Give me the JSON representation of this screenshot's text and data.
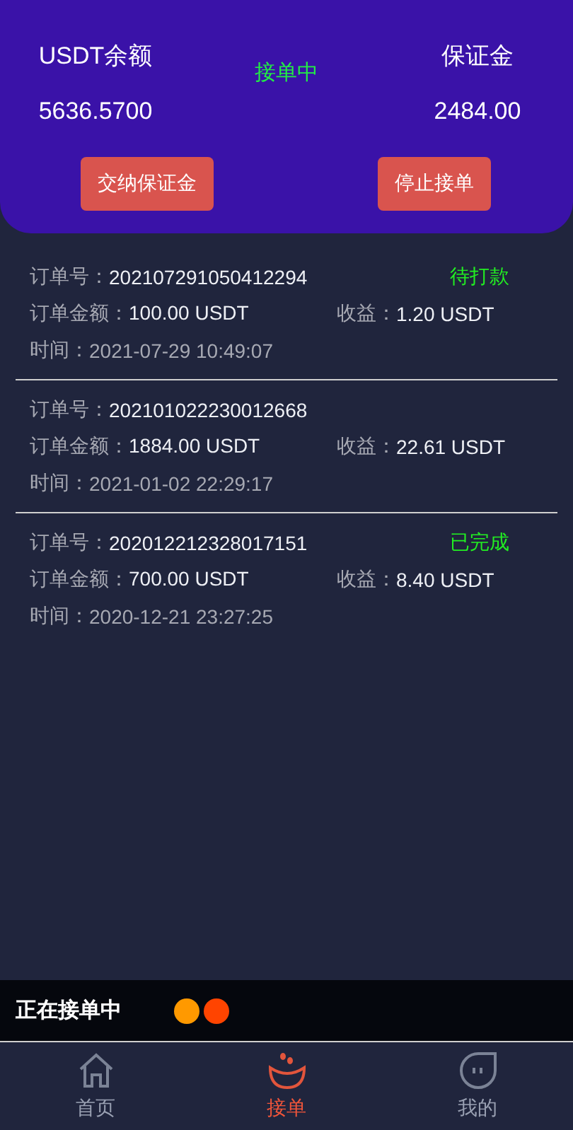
{
  "summary": {
    "balance_label": "USDT余额",
    "balance": "5636.5700",
    "status": "接单中",
    "deposit_label": "保证金",
    "deposit": "2484.00",
    "buttons": [
      "交纳保证金",
      "停止接单"
    ]
  },
  "orders": [
    {
      "no_label": "订单号：",
      "no": "202107291050412294",
      "status": "待打款",
      "amount_label": "订单金额：",
      "amount": "100.00 USDT",
      "profit_label": "收益：",
      "profit": "1.20 USDT",
      "time_label": "时间：",
      "time": "2021-07-29 10:49:07"
    },
    {
      "no_label": "订单号：",
      "no": "202101022230012668",
      "amount_label": "订单金额：",
      "amount": "1884.00 USDT",
      "profit_label": "收益：",
      "profit": "22.61 USDT",
      "time_label": "时间：",
      "time": "2021-01-02 22:29:17"
    },
    {
      "no_label": "订单号：",
      "no": "202012212328017151",
      "status": "已完成",
      "amount_label": "订单金额：",
      "amount": "700.00 USDT",
      "profit_label": "收益：",
      "profit": "8.40 USDT",
      "time_label": "时间：",
      "time": "2020-12-21 23:27:25"
    }
  ],
  "status_bar": {
    "text": "正在接单中",
    "dots": [
      {
        "color": "#ff9900"
      },
      {
        "color": "#ff4400"
      }
    ]
  },
  "tabs": [
    {
      "label": "首页",
      "kind": "home",
      "selected": false
    },
    {
      "label": "接单",
      "kind": "orders",
      "selected": true
    },
    {
      "label": "我的",
      "kind": "me",
      "selected": false
    }
  ]
}
